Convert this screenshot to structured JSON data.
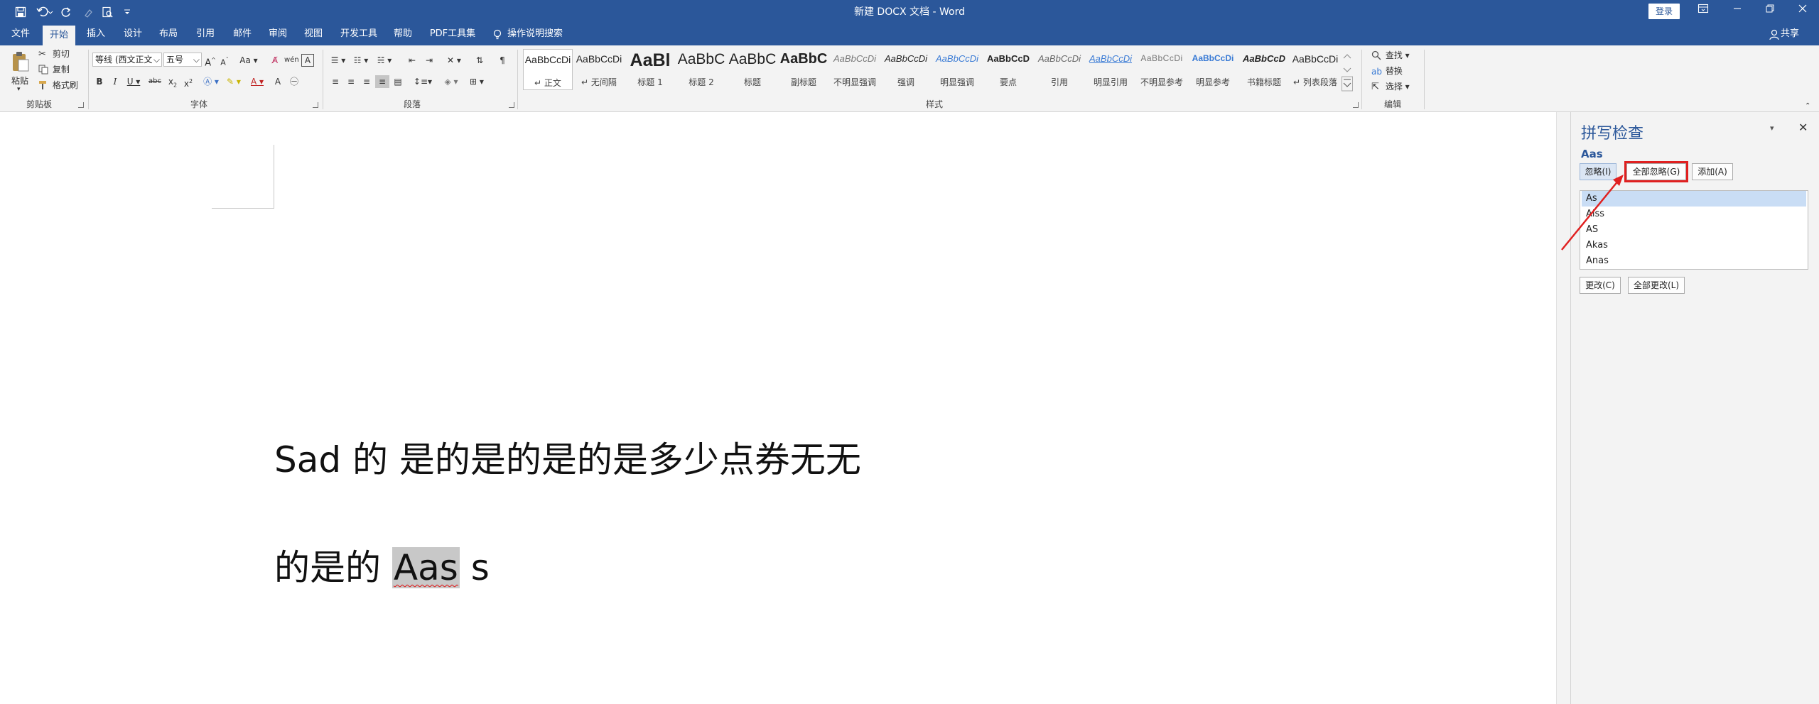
{
  "titlebar": {
    "title": "新建 DOCX 文档  -  Word",
    "login": "登录"
  },
  "menu": {
    "tabs": [
      "文件",
      "开始",
      "插入",
      "设计",
      "布局",
      "引用",
      "邮件",
      "审阅",
      "视图",
      "开发工具",
      "帮助",
      "PDF工具集"
    ],
    "tell_me": "操作说明搜索",
    "share": "共享"
  },
  "ribbon": {
    "clipboard": {
      "paste": "粘贴",
      "cut": "剪切",
      "copy": "复制",
      "format_painter": "格式刷",
      "label": "剪贴板"
    },
    "font": {
      "font_name": "等线 (西文正文",
      "font_size": "五号",
      "label": "字体"
    },
    "paragraph": {
      "label": "段落"
    },
    "styles": {
      "label": "样式",
      "items": [
        {
          "sample": "AaBbCcDi",
          "name": "正文"
        },
        {
          "sample": "AaBbCcDi",
          "name": "无间隔"
        },
        {
          "sample": "AaBl",
          "name": "标题 1"
        },
        {
          "sample": "AaBbC",
          "name": "标题 2"
        },
        {
          "sample": "AaBbC",
          "name": "标题"
        },
        {
          "sample": "AaBbC",
          "name": "副标题"
        },
        {
          "sample": "AaBbCcDi",
          "name": "不明显强调"
        },
        {
          "sample": "AaBbCcDi",
          "name": "强调"
        },
        {
          "sample": "AaBbCcDi",
          "name": "明显强调"
        },
        {
          "sample": "AaBbCcD",
          "name": "要点"
        },
        {
          "sample": "AaBbCcDi",
          "name": "引用"
        },
        {
          "sample": "AaBbCcDi",
          "name": "明显引用"
        },
        {
          "sample": "AaBbCcDi",
          "name": "不明显参考"
        },
        {
          "sample": "AaBbCcDi",
          "name": "明显参考"
        },
        {
          "sample": "AaBbCcD",
          "name": "书籍标题"
        },
        {
          "sample": "AaBbCcDi",
          "name": "列表段落"
        }
      ]
    },
    "editing": {
      "find": "查找",
      "replace": "替换",
      "select": "选择",
      "label": "编辑"
    }
  },
  "document": {
    "line1": "Sad 的  是的是的是的是多少点券无无",
    "line2_prefix": "的是的  ",
    "line2_highlight": "Aas",
    "line2_suffix": " s"
  },
  "spell_pane": {
    "title": "拼写检查",
    "word": "Aas",
    "ignore": "忽略(I)",
    "ignore_all": "全部忽略(G)",
    "add": "添加(A)",
    "suggestions": [
      "As",
      "Alss",
      "AS",
      "Akas",
      "Anas"
    ],
    "change": "更改(C)",
    "change_all": "全部更改(L)"
  },
  "colors": {
    "accent": "#2b579a",
    "highlight_box": "#e02020"
  }
}
